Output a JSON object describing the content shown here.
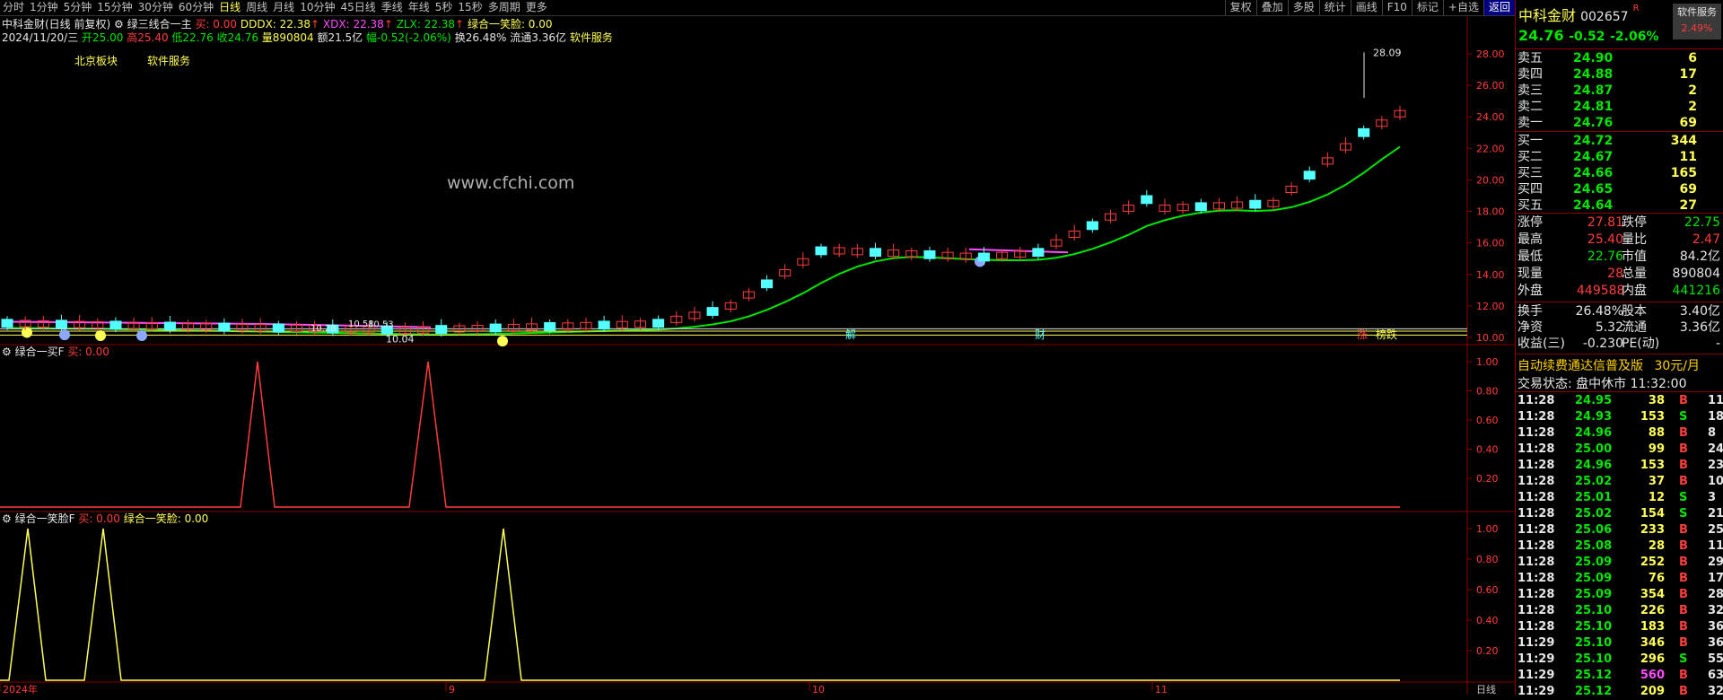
{
  "toolbar": {
    "periods": [
      "分时",
      "1分钟",
      "5分钟",
      "15分钟",
      "30分钟",
      "60分钟",
      "日线",
      "周线",
      "月线",
      "10分钟",
      "45日线",
      "季线",
      "年线",
      "5秒",
      "15秒",
      "多周期",
      "更多"
    ],
    "active_period": "日线",
    "buttons": [
      "复权",
      "叠加",
      "多股",
      "统计",
      "画线",
      "F10",
      "标记",
      "+自选",
      "返回"
    ],
    "active_button": "返回"
  },
  "main_panel": {
    "title": "中科金财(日线 前复权)",
    "indicator_name": "绿三线合一主",
    "buy_label": "买: 0.00",
    "dddx": "DDDX: 22.38",
    "xdx": "XDX: 22.38",
    "zlx": "ZLX: 22.38",
    "smile_label": "绿合一笑脸: 0.00",
    "info_date": "2024/11/20/三",
    "info_open": "开25.00",
    "info_high": "高25.40",
    "info_low": "低22.76",
    "info_close": "收24.76",
    "info_vol": "量890804",
    "info_amt": "额21.5亿",
    "info_chg": "幅-0.52(-2.06%)",
    "info_turn": "换26.48%",
    "info_float": "流通3.36亿",
    "info_sector": "软件服务",
    "sector_tags": [
      "北京板块",
      "软件服务"
    ],
    "watermark": "www.cfchi.com",
    "labels": {
      "max_price": "28.09",
      "min_price": "10.04",
      "p1": "10.58",
      "p2": "10.53",
      "p3": "10.28"
    },
    "event_marks": [
      "解",
      "财",
      "涨",
      "榜跌"
    ],
    "axis_ticks": [
      "28.00",
      "26.00",
      "24.00",
      "22.00",
      "20.00",
      "18.00",
      "16.00",
      "14.00",
      "12.00",
      "10.00"
    ]
  },
  "panel2": {
    "title": "绿合一买F",
    "value": "买: 0.00",
    "ticks": [
      "1.00",
      "0.80",
      "0.60",
      "0.40",
      "0.20"
    ]
  },
  "panel3": {
    "title": "绿合一笑脸F",
    "value": "买: 0.00",
    "value2": "绿合一笑脸: 0.00",
    "ticks": [
      "1.00",
      "0.80",
      "0.60",
      "0.40",
      "0.20"
    ]
  },
  "x_axis": {
    "labels": [
      "2024年",
      "9",
      "10",
      "11"
    ],
    "corner": "日线"
  },
  "chart_data": {
    "type": "candlestick",
    "ylim": [
      10,
      28.5
    ],
    "marks": {
      "high": 28.09,
      "low": 10.04
    }
  },
  "quote": {
    "name": "中科金财",
    "code": "002657",
    "r_mark": "R",
    "price": "24.76",
    "change": "-0.52",
    "change_pct": "-2.06%",
    "badge": "软件服务",
    "badge_pct": "2.49%",
    "asks": [
      {
        "label": "卖五",
        "price": "24.90",
        "vol": "6"
      },
      {
        "label": "卖四",
        "price": "24.88",
        "vol": "17"
      },
      {
        "label": "卖三",
        "price": "24.87",
        "vol": "2"
      },
      {
        "label": "卖二",
        "price": "24.81",
        "vol": "2"
      },
      {
        "label": "卖一",
        "price": "24.76",
        "vol": "69"
      }
    ],
    "bids": [
      {
        "label": "买一",
        "price": "24.72",
        "vol": "344"
      },
      {
        "label": "买二",
        "price": "24.67",
        "vol": "11"
      },
      {
        "label": "买三",
        "price": "24.66",
        "vol": "165"
      },
      {
        "label": "买四",
        "price": "24.65",
        "vol": "69"
      },
      {
        "label": "买五",
        "price": "24.64",
        "vol": "27"
      }
    ],
    "stats": [
      {
        "l1": "涨停",
        "v1": "27.81",
        "l2": "跌停",
        "v2": "22.75"
      },
      {
        "l1": "最高",
        "v1": "25.40",
        "l2": "量比",
        "v2": "2.47"
      },
      {
        "l1": "最低",
        "v1": "22.76",
        "l2": "市值",
        "v2": "84.2亿"
      },
      {
        "l1": "现量",
        "v1": "28",
        "l2": "总量",
        "v2": "890804"
      },
      {
        "l1": "外盘",
        "v1": "449588",
        "l2": "内盘",
        "v2": "441216"
      }
    ],
    "stats2": [
      {
        "l1": "换手",
        "v1": "26.48%",
        "l2": "股本",
        "v2": "3.40亿"
      },
      {
        "l1": "净资",
        "v1": "5.32",
        "l2": "流通",
        "v2": "3.36亿"
      },
      {
        "l1": "收益(三)",
        "v1": "-0.230",
        "l2": "PE(动)",
        "v2": "-"
      }
    ],
    "promo": "自动续费通达信普及版",
    "promo_price": "30元/月",
    "trade_status": "交易状态: 盘中休市 11:32:00",
    "ticks": [
      {
        "t": "11:28",
        "p": "24.95",
        "v": "38",
        "d": "B",
        "n": "11"
      },
      {
        "t": "11:28",
        "p": "24.93",
        "v": "153",
        "d": "S",
        "n": "18"
      },
      {
        "t": "11:28",
        "p": "24.96",
        "v": "88",
        "d": "B",
        "n": "8"
      },
      {
        "t": "11:28",
        "p": "25.00",
        "v": "99",
        "d": "B",
        "n": "24"
      },
      {
        "t": "11:28",
        "p": "24.96",
        "v": "153",
        "d": "B",
        "n": "23"
      },
      {
        "t": "11:28",
        "p": "25.02",
        "v": "37",
        "d": "B",
        "n": "10"
      },
      {
        "t": "11:28",
        "p": "25.01",
        "v": "12",
        "d": "S",
        "n": "3"
      },
      {
        "t": "11:28",
        "p": "25.02",
        "v": "154",
        "d": "S",
        "n": "21"
      },
      {
        "t": "11:28",
        "p": "25.06",
        "v": "233",
        "d": "B",
        "n": "25"
      },
      {
        "t": "11:28",
        "p": "25.08",
        "v": "28",
        "d": "B",
        "n": "11"
      },
      {
        "t": "11:28",
        "p": "25.09",
        "v": "252",
        "d": "B",
        "n": "29"
      },
      {
        "t": "11:28",
        "p": "25.09",
        "v": "76",
        "d": "B",
        "n": "17"
      },
      {
        "t": "11:28",
        "p": "25.09",
        "v": "354",
        "d": "B",
        "n": "28"
      },
      {
        "t": "11:28",
        "p": "25.10",
        "v": "226",
        "d": "B",
        "n": "32"
      },
      {
        "t": "11:28",
        "p": "25.10",
        "v": "183",
        "d": "B",
        "n": "36"
      },
      {
        "t": "11:29",
        "p": "25.10",
        "v": "346",
        "d": "B",
        "n": "36"
      },
      {
        "t": "11:29",
        "p": "25.10",
        "v": "296",
        "d": "S",
        "n": "55"
      },
      {
        "t": "11:29",
        "p": "25.12",
        "v": "560",
        "d": "B",
        "n": "63"
      },
      {
        "t": "11:29",
        "p": "25.12",
        "v": "209",
        "d": "B",
        "n": "32"
      }
    ]
  }
}
